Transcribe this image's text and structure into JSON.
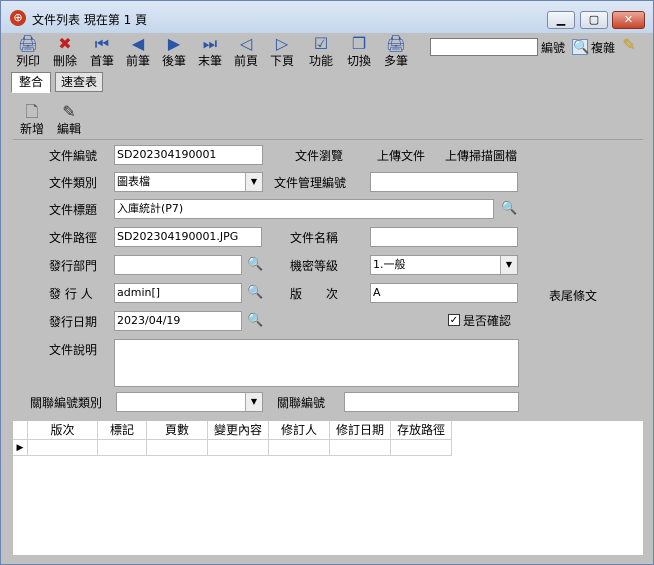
{
  "window": {
    "title": "文件列表  現在第 1 頁",
    "minimize": "▁",
    "maximize": "▢",
    "close": "✕"
  },
  "toolbar": [
    {
      "label": "列印",
      "icon": "🖨"
    },
    {
      "label": "刪除",
      "icon": "✖"
    },
    {
      "label": "首筆",
      "icon": "⏮"
    },
    {
      "label": "前筆",
      "icon": "◀"
    },
    {
      "label": "後筆",
      "icon": "▶"
    },
    {
      "label": "末筆",
      "icon": "⏭"
    },
    {
      "label": "前頁",
      "icon": "◁"
    },
    {
      "label": "下頁",
      "icon": "▷"
    },
    {
      "label": "功能",
      "icon": "☑"
    },
    {
      "label": "切換",
      "icon": "❐"
    },
    {
      "label": "多筆",
      "icon": "🖨"
    }
  ],
  "search": {
    "value": "",
    "label_code": "編號",
    "label_copy": "複雜"
  },
  "tabs": [
    {
      "label": "整合"
    },
    {
      "label": "速查表"
    }
  ],
  "subtoolbar": [
    {
      "label": "新增",
      "icon": "🗋"
    },
    {
      "label": "編輯",
      "icon": "✎"
    }
  ],
  "form": {
    "doc_no_label": "文件編號",
    "doc_no": "SD202304190001",
    "browse_label": "文件瀏覽",
    "upload_label": "上傳文件",
    "scan_label": "上傳掃描圖檔",
    "doc_type_label": "文件類別",
    "doc_type": "圖表檔",
    "mgmt_no_label": "文件管理編號",
    "mgmt_no": "",
    "title_label": "文件標題",
    "title": "入庫統計(P7)",
    "path_label": "文件路徑",
    "path": "SD202304190001.JPG",
    "file_name_label": "文件名稱",
    "file_name": "",
    "dept_label": "發行部門",
    "dept": "",
    "secret_label": "機密等級",
    "secret": "1.一般",
    "issuer_label": "發 行 人",
    "issuer": "admin[]",
    "version_label": "版　　次",
    "version": "A",
    "footer_label": "表尾條文",
    "issue_date_label": "發行日期",
    "issue_date": "2023/04/19",
    "confirm_label": "是否確認",
    "confirmed": true,
    "desc_label": "文件說明",
    "desc": "",
    "rel_type_label": "關聯編號類別",
    "rel_type": "",
    "rel_no_label": "關聯編號",
    "rel_no": ""
  },
  "grid": {
    "columns": [
      "版次",
      "標記",
      "頁數",
      "變更內容",
      "修訂人",
      "修訂日期",
      "存放路徑"
    ]
  }
}
